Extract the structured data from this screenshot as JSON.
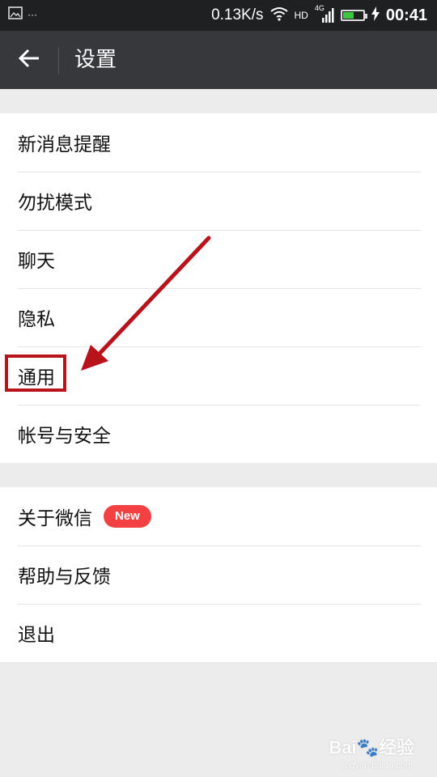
{
  "status_bar": {
    "left_icons": [
      "image-icon",
      "more-dots-icon"
    ],
    "more_text": "···",
    "net_speed": "0.13K/s",
    "hd_label": "HD",
    "network_label": "4G",
    "time": "00:41",
    "battery_level": 0.55,
    "battery_color": "#3ec63e"
  },
  "header": {
    "back_icon": "arrow-left-icon",
    "title": "设置"
  },
  "settings": {
    "group1": [
      {
        "label": "新消息提醒"
      },
      {
        "label": "勿扰模式"
      },
      {
        "label": "聊天"
      },
      {
        "label": "隐私"
      },
      {
        "label": "通用"
      },
      {
        "label": "帐号与安全"
      }
    ],
    "group2": [
      {
        "label": "关于微信",
        "badge": "New"
      },
      {
        "label": "帮助与反馈"
      },
      {
        "label": "退出"
      }
    ]
  },
  "annotation": {
    "color": "#b8121b",
    "highlighted_item": "通用"
  },
  "watermark": {
    "text": "Bai🐾经验",
    "sub": "jingyan.baidu.com"
  },
  "colors": {
    "titlebar_bg": "#37383c",
    "statusbar_bg": "#1f2022",
    "badge_bg": "#f34043",
    "page_bg": "#ececec"
  }
}
